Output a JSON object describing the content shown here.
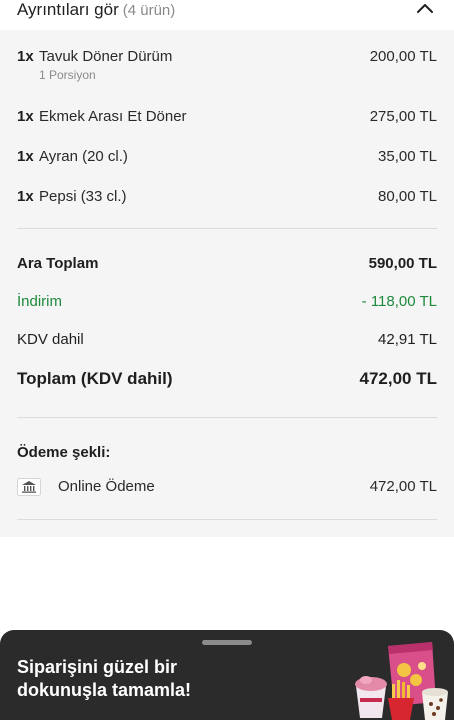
{
  "header": {
    "title": "Ayrıntıları gör",
    "count": "(4 ürün)",
    "toggle_icon": "chevron-up-icon"
  },
  "items": [
    {
      "qty": "1x",
      "name": "Tavuk Döner Dürüm",
      "sub": "1 Porsiyon",
      "price": "200,00 TL"
    },
    {
      "qty": "1x",
      "name": "Ekmek Arası Et Döner",
      "sub": "",
      "price": "275,00 TL"
    },
    {
      "qty": "1x",
      "name": "Ayran (20 cl.)",
      "sub": "",
      "price": "35,00 TL"
    },
    {
      "qty": "1x",
      "name": "Pepsi (33 cl.)",
      "sub": "",
      "price": "80,00 TL"
    }
  ],
  "summary": {
    "subtotal_label": "Ara Toplam",
    "subtotal_value": "590,00 TL",
    "discount_label": "İndirim",
    "discount_value": "- 118,00 TL",
    "vat_label": "KDV dahil",
    "vat_value": "42,91 TL",
    "total_label": "Toplam (KDV dahil)",
    "total_value": "472,00 TL"
  },
  "payment": {
    "title": "Ödeme şekli:",
    "method": "Online Ödeme",
    "amount": "472,00 TL",
    "icon": "bank-icon"
  },
  "banner": {
    "text": "Siparişini güzel bir dokunuşla tamamla!"
  },
  "colors": {
    "discount_green": "#1e8a3c",
    "panel_bg": "#f5f5f5",
    "banner_bg": "#2b2b2b"
  }
}
